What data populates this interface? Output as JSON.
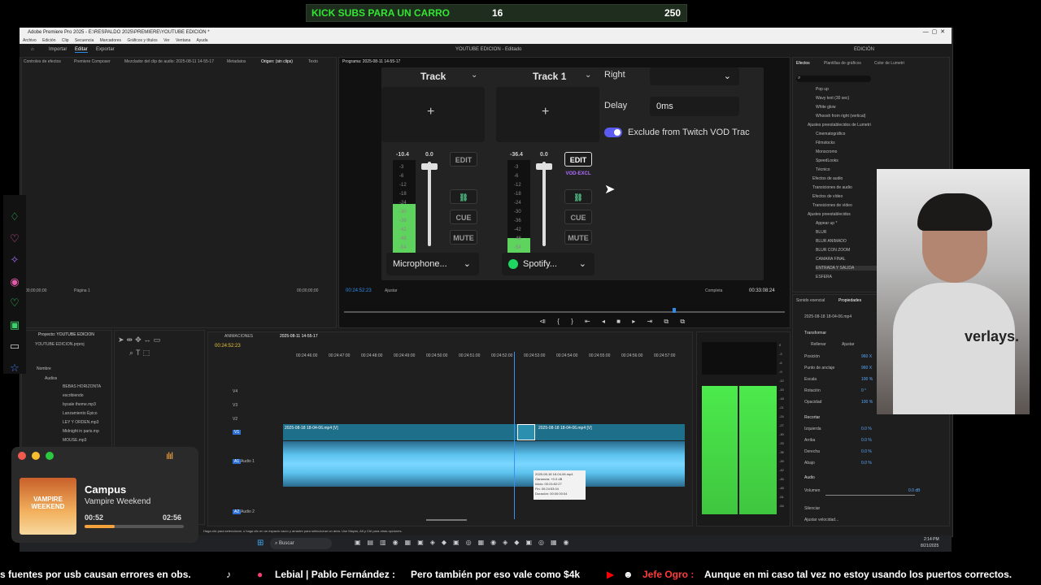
{
  "banner": {
    "text": "KICK SUBS PARA UN CARRO",
    "current": "16",
    "goal": "250"
  },
  "window": {
    "title": "Adobe Premiere Pro 2025 - E:\\RESPALDO 2025\\PREMIERE\\YOUTUBE EDICION *",
    "menu": [
      "Archivo",
      "Edición",
      "Clip",
      "Secuencia",
      "Marcadores",
      "Gráficos y títulos",
      "Ver",
      "Ventana",
      "Ayuda"
    ],
    "tabs": [
      "Importar",
      "Editar",
      "Exportar"
    ],
    "project_name": "YOUTUBE EDICION - Editado",
    "workspace": "EDICIÓN"
  },
  "source_panel": {
    "tabs": [
      "Controles de efectos",
      "Premiere Composer",
      "Mezclador del clip de audio: 2025-08-11 14-55-17",
      "Metadatos",
      "Origen: (sin clips)",
      "Texto"
    ],
    "tc_left": "00;00;00;00",
    "page": "Página 1",
    "tc_right": "00;00;00;00"
  },
  "program": {
    "title": "Programa: 2025-08-11 14-55-17",
    "tc": "00:24:52:23",
    "fit": "Ajustar",
    "quality": "Completa",
    "duration": "00:33:08:24"
  },
  "overlay": {
    "track_a": {
      "label": "Track",
      "meter_top": "-10.4",
      "fader": "0.0",
      "edit": "EDIT",
      "cue": "CUE",
      "mute": "MUTE",
      "source": "Microphone...",
      "scale": [
        "-3",
        "-6",
        "-12",
        "-18",
        "-24",
        "-30",
        "-36",
        "-42",
        "-48",
        "-54"
      ]
    },
    "track_b": {
      "label": "Track 1",
      "meter_top": "-36.4",
      "fader": "0.0",
      "edit": "EDIT",
      "tag": "VOD-EXCL",
      "cue": "CUE",
      "mute": "MUTE",
      "source": "Spotify...",
      "scale": [
        "-3",
        "-6",
        "-12",
        "-18",
        "-24",
        "-30",
        "-36",
        "-42",
        "-48",
        "-54"
      ]
    },
    "right_label": "Right",
    "delay_label": "Delay",
    "delay_value": "0ms",
    "exclude_label": "Exclude from Twitch VOD Trac"
  },
  "effects_panel": {
    "tabs": [
      "Efectos",
      "Plantillas de gráficos",
      "Color de Lumetri"
    ],
    "items": [
      "Pop up",
      "Wavy text (30 sec)",
      "White glow",
      "Whoosh from right (vertical)",
      "Ajustes preestablecidos de Lumetri",
      "Cinematográfico",
      "Filmstocks",
      "Monocromo",
      "SpeedLooks",
      "Técnico",
      "Efectos de audio",
      "Transiciones de audio",
      "Efectos de vídeo",
      "Transiciones de vídeo",
      "Ajustes preestablecidos",
      "Appear up *",
      "BLUR",
      "BLUR ANIMADO",
      "BLUR CON ZOOM",
      "CAMARA FINAL",
      "ENTRADA Y SALIDA",
      "ESFERA"
    ]
  },
  "props_panel": {
    "tabs": [
      "Sonido esencial",
      "Propiedades"
    ],
    "clip": "2025-08-18 18-04-06.mp4",
    "section_transform": "Transformar",
    "fill": "Rellenar",
    "fit": "Ajustar",
    "rows": [
      {
        "k": "Posición",
        "v": "960 X"
      },
      {
        "k": "Punto de anclaje",
        "v": "960 X"
      },
      {
        "k": "Escala",
        "v": "100 %"
      },
      {
        "k": "Rotación",
        "v": "0 °"
      },
      {
        "k": "Opacidad",
        "v": "100 %"
      }
    ],
    "section_crop": "Recortar",
    "crop": [
      {
        "k": "Izquierda",
        "v": "0.0 %"
      },
      {
        "k": "Arriba",
        "v": "0.0 %"
      },
      {
        "k": "Derecha",
        "v": "0.0 %"
      },
      {
        "k": "Abajo",
        "v": "0.0 %"
      }
    ],
    "section_audio": "Audio",
    "volume": "Volumen",
    "volume_val": "0.0 dB",
    "silence": "Silenciar",
    "speed": "Ajustar velocidad..."
  },
  "project_panel": {
    "title": "Proyecto: YOUTUBE EDICION",
    "file": "YOUTUBE EDICION.prproj",
    "col": "Nombre",
    "items": [
      "Audios",
      "BEBAS HORIZONTA",
      "escribiendo",
      "bysale theme.mp3",
      "Lanzamiento Épico",
      "LEY Y ORDEN.mp3",
      "Midnight in paris.mp",
      "MOUSE.mp3"
    ]
  },
  "timeline": {
    "tabs": [
      "ANIMACIONES",
      "2025-08-11 14-55-17"
    ],
    "tc": "00:24:52:23",
    "ruler": [
      "00:24:46:00",
      "00:24:47:00",
      "00:24:48:00",
      "00:24:49:00",
      "00:24:50:00",
      "00:24:51:00",
      "00:24:52:00",
      "00:24:53:00",
      "00:24:54:00",
      "00:24:55:00",
      "00:24:56:00",
      "00:24:57:00"
    ],
    "tracks": [
      "V4",
      "V3",
      "V2",
      "V1",
      "A1",
      "A2"
    ],
    "audio1": "Audio 1",
    "audio2": "Audio 2",
    "clip1": "2025-08-18 18-04-06.mp4 [V]",
    "clip2": "2025-08-18 18-04-06.mp4 [V]",
    "tooltip": [
      "2025-08-18 18-04-06.mp4",
      "Ganancia: +0.0 dB",
      "Inicio: 00:24:52:27",
      "Fin: 00:24:53:04",
      "Duración: 00:00:00:04"
    ]
  },
  "meter_scale": [
    "0",
    "-3",
    "-6",
    "-9",
    "-12",
    "-15",
    "-18",
    "-21",
    "-24",
    "-27",
    "-30",
    "-33",
    "-36",
    "-39",
    "-42",
    "-45",
    "-48",
    "-51",
    "-54"
  ],
  "status_hint": "Haga clic para seleccionar, o haga clic en un espacio vacío y arrastre para seleccionar un área. Use Mayús, Alt y Ctrl para otras opciones.",
  "taskbar": {
    "search": "Buscar",
    "time": "2:14 PM",
    "date": "8/21/2025"
  },
  "player": {
    "song": "Campus",
    "artist": "Vampire Weekend",
    "elapsed": "00:52",
    "total": "02:56",
    "album_text": "VAMPIRE WEEKEND",
    "progress": 0.3
  },
  "ticker": [
    {
      "text": "s fuentes por usb causan errores en obs."
    },
    {
      "user": "Lebial | Pablo Fernández :",
      "text": "Pero también por eso vale como $4k"
    },
    {
      "user": "Jefe Ogro :",
      "text": "Aunque en mi caso tal vez no estoy usando los puertos correctos."
    }
  ],
  "cam_shirt": "verlays."
}
